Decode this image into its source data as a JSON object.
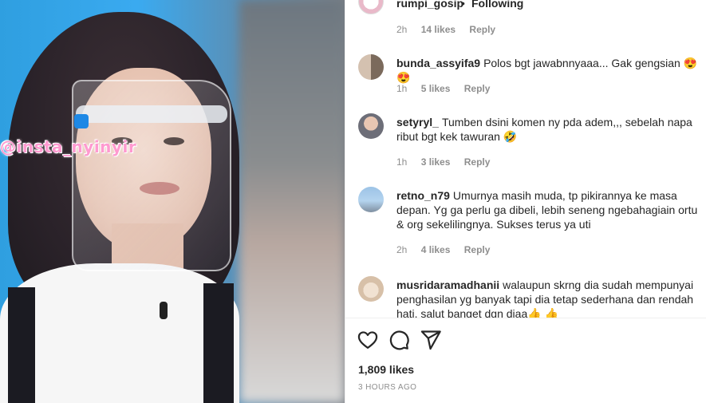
{
  "post": {
    "author": "rumpi_gosip",
    "separator": "•",
    "follow_status": "Following",
    "media_watermark": "@insta_nyinyir",
    "likes": "1,809 likes",
    "time_ago": "3 HOURS AGO"
  },
  "previous_comment_meta": {
    "time": "2h",
    "likes": "14 likes",
    "reply": "Reply"
  },
  "comments": [
    {
      "username": "bunda_assyifa9",
      "text": "Polos bgt jawabnnyaaa... Gak gengsian 😍😍",
      "time": "1h",
      "likes": "5 likes",
      "reply": "Reply"
    },
    {
      "username": "setyryl_",
      "text": "Tumben dsini komen ny pda adem,,, sebelah napa ribut bgt kek tawuran 🤣",
      "time": "1h",
      "likes": "3 likes",
      "reply": "Reply"
    },
    {
      "username": "retno_n79",
      "text": "Umurnya masih muda, tp pikirannya ke masa depan. Yg ga perlu ga dibeli, lebih seneng ngebahagiain ortu & org sekelilingnya. Sukses terus ya uti",
      "time": "2h",
      "likes": "4 likes",
      "reply": "Reply"
    },
    {
      "username": "musridaramadhanii",
      "text": "walaupun skrng dia sudah mempunyai penghasilan yg banyak tapi dia tetap sederhana dan rendah hati. salut banget dgn diaa👍 👍"
    }
  ],
  "icons": {
    "like": "heart-icon",
    "comment": "comment-icon",
    "share": "share-icon"
  }
}
